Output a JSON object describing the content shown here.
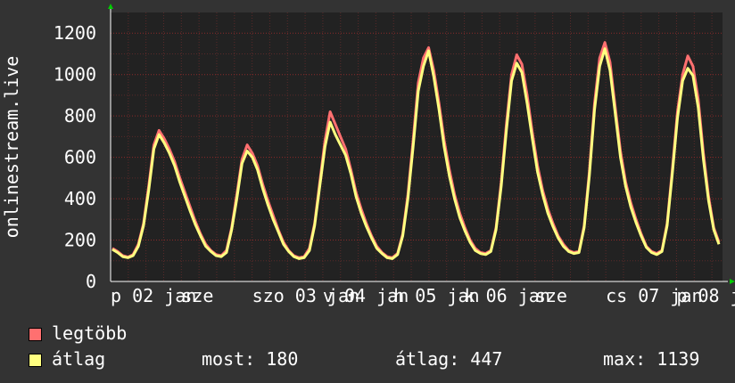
{
  "chart_data": {
    "type": "line",
    "ylabel": "onlinestream.live",
    "ylim": [
      0,
      1300
    ],
    "yticks": [
      0,
      200,
      400,
      600,
      800,
      1000,
      1200
    ],
    "xtick_labels": [
      "p 02 jan",
      "sze",
      "szo 03 jan",
      "v 04 jan",
      "h 05 jan",
      "k 06 jan",
      "sze",
      "cs 07 jan",
      "p 08 jan"
    ],
    "series": [
      {
        "name": "legtöbb",
        "color": "#ff7070",
        "values": [
          160,
          145,
          125,
          118,
          130,
          180,
          280,
          460,
          660,
          730,
          690,
          640,
          580,
          500,
          430,
          360,
          290,
          230,
          180,
          150,
          130,
          125,
          150,
          260,
          420,
          590,
          660,
          620,
          560,
          470,
          390,
          320,
          250,
          190,
          150,
          125,
          115,
          120,
          160,
          280,
          480,
          680,
          820,
          760,
          700,
          640,
          540,
          430,
          350,
          280,
          220,
          170,
          140,
          120,
          115,
          135,
          230,
          420,
          680,
          960,
          1080,
          1130,
          1020,
          860,
          680,
          540,
          420,
          330,
          260,
          200,
          160,
          140,
          135,
          150,
          260,
          480,
          760,
          1000,
          1095,
          1050,
          900,
          720,
          560,
          440,
          350,
          280,
          220,
          180,
          150,
          140,
          145,
          270,
          530,
          860,
          1080,
          1155,
          1060,
          840,
          630,
          480,
          380,
          300,
          230,
          170,
          145,
          135,
          150,
          280,
          540,
          820,
          1000,
          1090,
          1040,
          880,
          620,
          410,
          260,
          190
        ]
      },
      {
        "name": "átlag",
        "color": "#ffff80",
        "values": [
          155,
          140,
          120,
          115,
          125,
          170,
          270,
          440,
          640,
          710,
          670,
          620,
          560,
          480,
          410,
          340,
          275,
          220,
          170,
          145,
          125,
          120,
          140,
          250,
          400,
          570,
          630,
          600,
          540,
          450,
          370,
          300,
          240,
          180,
          145,
          120,
          110,
          115,
          150,
          270,
          460,
          650,
          770,
          710,
          660,
          610,
          520,
          410,
          330,
          265,
          210,
          160,
          135,
          115,
          110,
          130,
          220,
          400,
          650,
          920,
          1040,
          1115,
          990,
          830,
          650,
          510,
          400,
          310,
          245,
          190,
          150,
          135,
          130,
          145,
          250,
          460,
          730,
          970,
          1055,
          1010,
          860,
          690,
          530,
          420,
          330,
          265,
          210,
          170,
          145,
          135,
          140,
          260,
          510,
          830,
          1040,
          1125,
          1020,
          810,
          600,
          460,
          360,
          285,
          220,
          165,
          140,
          130,
          145,
          270,
          520,
          790,
          970,
          1030,
          995,
          840,
          590,
          390,
          250,
          180
        ]
      }
    ]
  },
  "legend": [
    {
      "label": "legtöbb",
      "color": "#ff7070"
    },
    {
      "label": "átlag",
      "color": "#ffff80"
    }
  ],
  "stats": {
    "most": "most: 180",
    "avg": "átlag: 447",
    "max": "max: 1139"
  },
  "colors": {
    "background": "#333333",
    "plot_background": "#222222",
    "grid": "#8b2a2a",
    "axis": "#ffffff",
    "arrow": "#00cc00"
  }
}
